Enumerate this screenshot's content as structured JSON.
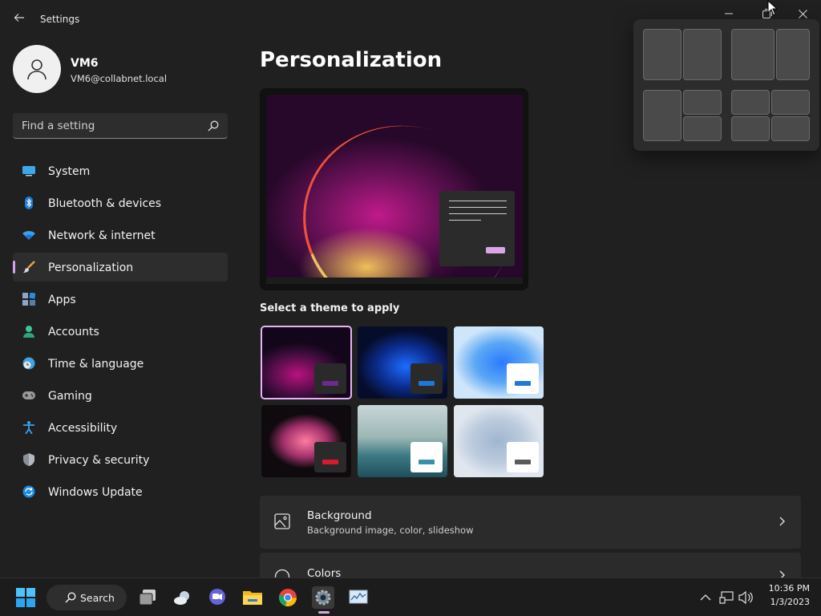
{
  "app": {
    "title": "Settings"
  },
  "profile": {
    "name": "VM6",
    "email": "VM6@collabnet.local"
  },
  "search": {
    "placeholder": "Find a setting"
  },
  "sidebar": {
    "items": [
      {
        "label": "System",
        "icon": "system-icon"
      },
      {
        "label": "Bluetooth & devices",
        "icon": "bluetooth-icon"
      },
      {
        "label": "Network & internet",
        "icon": "wifi-icon"
      },
      {
        "label": "Personalization",
        "icon": "brush-icon",
        "active": true
      },
      {
        "label": "Apps",
        "icon": "apps-icon"
      },
      {
        "label": "Accounts",
        "icon": "person-icon"
      },
      {
        "label": "Time & language",
        "icon": "clock-globe-icon"
      },
      {
        "label": "Gaming",
        "icon": "gamepad-icon"
      },
      {
        "label": "Accessibility",
        "icon": "accessibility-icon"
      },
      {
        "label": "Privacy & security",
        "icon": "shield-icon"
      },
      {
        "label": "Windows Update",
        "icon": "update-icon"
      }
    ]
  },
  "main": {
    "title": "Personalization",
    "themes_heading": "Select a theme to apply",
    "themes": [
      {
        "name": "theme-glow",
        "accent": "#6b2a8c",
        "selected": true
      },
      {
        "name": "theme-bloom-dark",
        "accent": "#1e78d6"
      },
      {
        "name": "theme-bloom-light",
        "accent": "#1e78d6"
      },
      {
        "name": "theme-flower",
        "accent": "#d81a2a"
      },
      {
        "name": "theme-lake",
        "accent": "#3b8fa8"
      },
      {
        "name": "theme-flow",
        "accent": "#5a5a5a"
      }
    ],
    "cards": [
      {
        "title": "Background",
        "subtitle": "Background image, color, slideshow",
        "icon": "image-icon"
      },
      {
        "title": "Colors",
        "subtitle": "",
        "icon": "palette-icon"
      }
    ]
  },
  "taskbar": {
    "search_label": "Search",
    "time": "10:36 PM",
    "date": "1/3/2023"
  },
  "colors": {
    "accent": "#d9a5e6",
    "background": "#202020",
    "card": "#2b2b2b"
  }
}
